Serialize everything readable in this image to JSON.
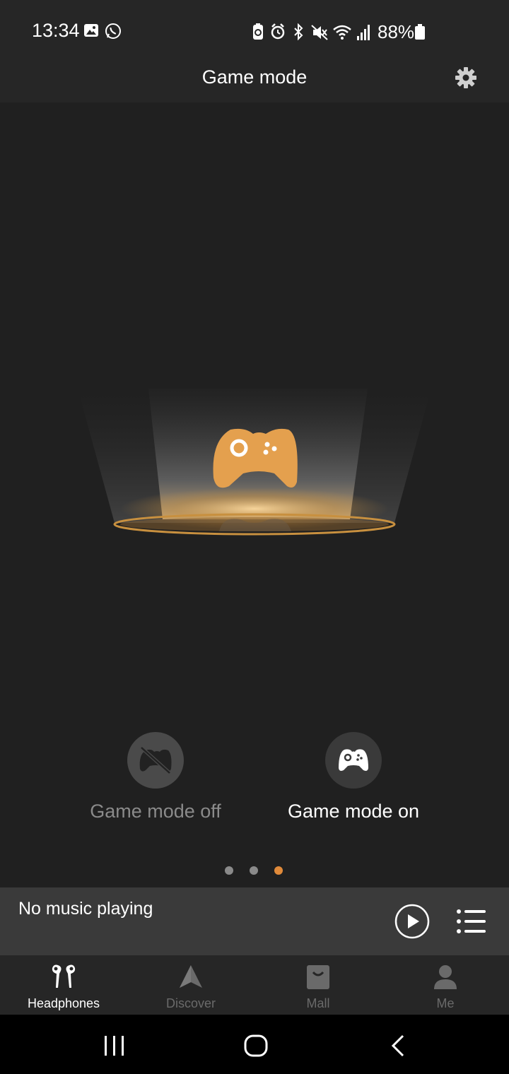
{
  "status_bar": {
    "time": "13:34",
    "battery": "88%",
    "icons_left": [
      "gallery-icon",
      "whatsapp-icon"
    ],
    "icons_right": [
      "battery-saver-icon",
      "alarm-icon",
      "bluetooth-icon",
      "mute-icon",
      "wifi-icon",
      "signal-icon"
    ]
  },
  "header": {
    "title": "Game mode",
    "settings_icon": "gear-icon"
  },
  "hero": {
    "icon": "gamepad-icon",
    "accent_color": "#e4a04e"
  },
  "modes": {
    "off_label": "Game mode off",
    "on_label": "Game mode on",
    "selected": "on"
  },
  "pager": {
    "count": 3,
    "active_index": 2,
    "active_color": "#e08a3a"
  },
  "player": {
    "status": "No music playing"
  },
  "nav": {
    "items": [
      {
        "label": "Headphones",
        "icon": "earbuds-icon",
        "active": true
      },
      {
        "label": "Discover",
        "icon": "discover-icon",
        "active": false
      },
      {
        "label": "Mall",
        "icon": "shopping-bag-icon",
        "active": false
      },
      {
        "label": "Me",
        "icon": "person-icon",
        "active": false
      }
    ]
  }
}
